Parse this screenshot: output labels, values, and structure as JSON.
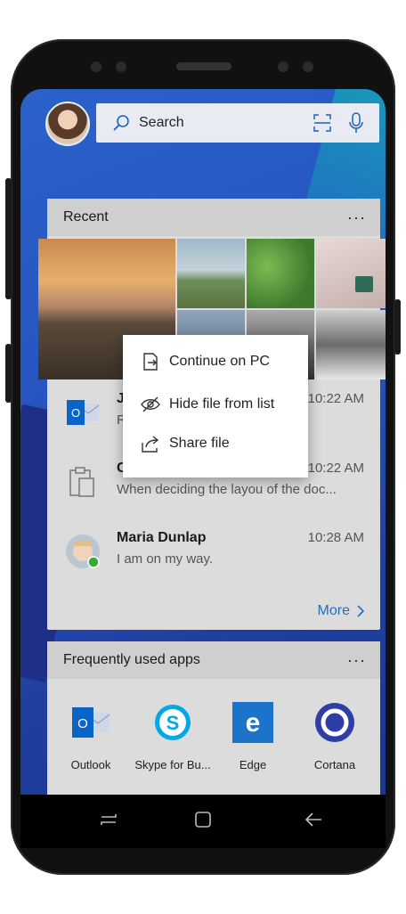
{
  "search": {
    "label": "Search"
  },
  "recent": {
    "title": "Recent",
    "more_label": "More",
    "items": [
      {
        "title": "J",
        "subtitle": "R",
        "time": "10:22 AM"
      },
      {
        "title": "Copy",
        "subtitle": "When deciding the layou of the doc...",
        "time": "10:22 AM"
      },
      {
        "title": "Maria Dunlap",
        "subtitle": "I am on my way.",
        "time": "10:28 AM"
      }
    ]
  },
  "context_menu": {
    "items": [
      {
        "label": "Continue on PC",
        "icon": "continue-on-pc-icon"
      },
      {
        "label": "Hide file from list",
        "icon": "eye-slash-icon"
      },
      {
        "label": "Share file",
        "icon": "share-icon"
      }
    ]
  },
  "apps": {
    "title": "Frequently used apps",
    "items": [
      {
        "label": "Outlook",
        "color": "#0a64c8"
      },
      {
        "label": "Skype for Bu...",
        "color": "#00a9e6"
      },
      {
        "label": "Edge",
        "color": "#1b74c9"
      },
      {
        "label": "Cortana",
        "color": "#2f3da6"
      },
      {
        "label": "",
        "color": "#d24726"
      },
      {
        "label": "",
        "color": "#80397b"
      },
      {
        "label": "",
        "color": "#2b69c9"
      },
      {
        "label": "",
        "color": "#107c10"
      }
    ]
  },
  "colors": {
    "accent": "#1f6fc3",
    "card": "#dcdcdc",
    "header": "#cfcfcf"
  }
}
